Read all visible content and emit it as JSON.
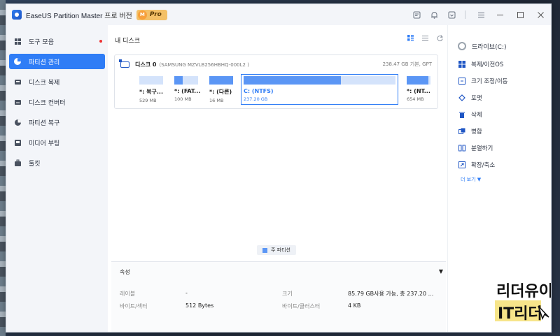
{
  "app": {
    "name": "EaseUS Partition Master",
    "edition": "프로 버전",
    "badge": "Pro",
    "badge_letter": "M"
  },
  "titlebar": {
    "icons": [
      "feedback-icon",
      "bell-icon",
      "download-icon",
      "menu-icon"
    ],
    "window_controls": [
      "minimize-icon",
      "maximize-icon",
      "close-icon"
    ]
  },
  "sidebar": {
    "items": [
      {
        "label": "도구 모음",
        "icon": "toolbox-icon",
        "badge": true
      },
      {
        "label": "파티션 관리",
        "icon": "pie-icon",
        "active": true
      },
      {
        "label": "디스크 복제",
        "icon": "disk-clone-icon"
      },
      {
        "label": "디스크 컨버터",
        "icon": "disk-convert-icon"
      },
      {
        "label": "파티션 복구",
        "icon": "partition-recovery-icon"
      },
      {
        "label": "미디어 부팅",
        "icon": "media-boot-icon"
      },
      {
        "label": "툴킷",
        "icon": "toolkit-icon"
      }
    ]
  },
  "main": {
    "title": "내 디스크",
    "disk": {
      "name": "디스크 0",
      "model": "(SAMSUNG MZVLB256HBHQ-000L2 )",
      "info": "238.47 GB 기본, GPT"
    },
    "partitions": [
      {
        "label": "*: 복구...",
        "size": "529 MB",
        "fill": 0.0
      },
      {
        "label": "*: (FAT...",
        "size": "100 MB",
        "fill": 0.35
      },
      {
        "label": "*: (다른)",
        "size": "16 MB",
        "fill": 1.0
      },
      {
        "label": "C: (NTFS)",
        "size": "237.20 GB",
        "fill": 0.64,
        "selected": true
      },
      {
        "label": "*: (NT...",
        "size": "654 MB",
        "fill": 0.9
      }
    ],
    "legend": "주 파티션",
    "properties": {
      "title": "속성",
      "rows": [
        {
          "label": "레이블",
          "value": "-"
        },
        {
          "label": "바이트/섹터",
          "value": "512 Bytes"
        },
        {
          "label": "크기",
          "value": "85.79 GB사용 가능,  총 237.20 ..."
        },
        {
          "label": "바이트/클러스터",
          "value": "4 KB"
        }
      ]
    }
  },
  "operations": {
    "drive": "드라이브(C:)",
    "items": [
      {
        "label": "복제/이전OS",
        "icon": "windows-icon"
      },
      {
        "label": "크기 조정/이동",
        "icon": "resize-icon"
      },
      {
        "label": "포맷",
        "icon": "format-icon"
      },
      {
        "label": "삭제",
        "icon": "trash-icon"
      },
      {
        "label": "병합",
        "icon": "merge-icon"
      },
      {
        "label": "분열하기",
        "icon": "split-icon"
      },
      {
        "label": "확장/축소",
        "icon": "extend-icon"
      }
    ],
    "more": "더 보기 ▼"
  },
  "colors": {
    "accent": "#2f7df6",
    "bar_used": "#5b96f5",
    "bar_free": "#d4e3fb"
  }
}
